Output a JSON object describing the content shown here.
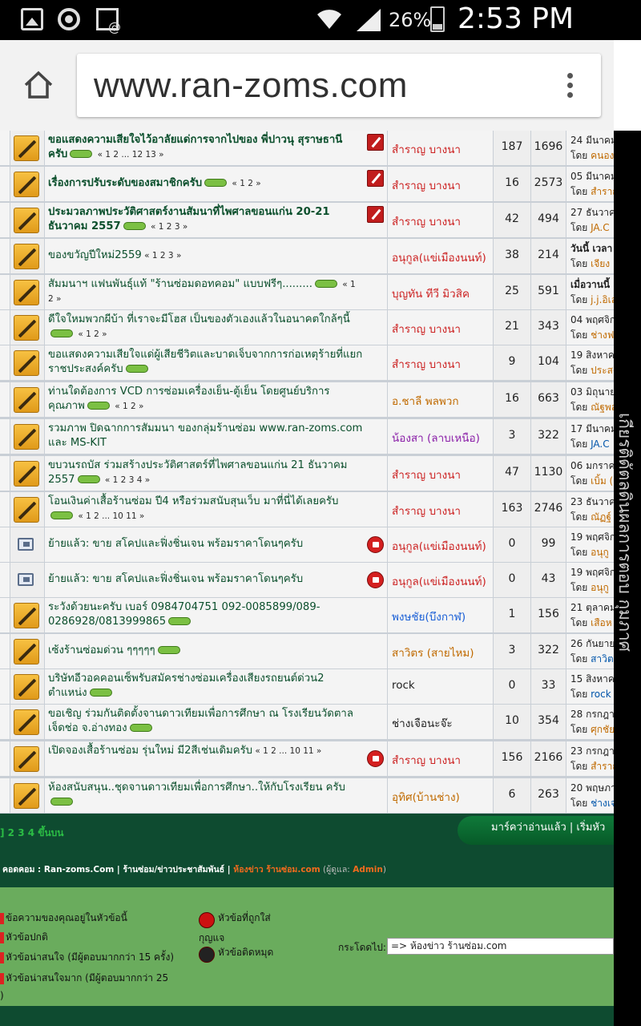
{
  "status": {
    "battery": "26%",
    "time": "2:53 PM"
  },
  "browser": {
    "url": "www.ran-zoms.com"
  },
  "rows": [
    {
      "icon": "topic",
      "title": "ขอแสดงความเสียใจไว้อาลัยแด่การจากไปของ พี่ปาวนุ สุราษธานี ครับ",
      "pages": "« 1 2 ... 12 13 »",
      "bold": true,
      "new": true,
      "badge": "sticky",
      "author": "สำราญ บางนา",
      "author_color": "#cc2222",
      "replies": "187",
      "views": "1696",
      "last1": "24 มีนาคม",
      "last2a": "โดย ",
      "last2b": "คนอง"
    },
    {
      "icon": "topic",
      "title": "เรื่องการปรับระดับของสมาชิกครับ",
      "pages": "« 1 2 »",
      "bold": true,
      "new": true,
      "badge": "sticky",
      "author": "สำราญ บางนา",
      "author_color": "#cc2222",
      "replies": "16",
      "views": "2573",
      "last1": "05 มีนาคม",
      "last2a": "โดย ",
      "last2b": "สำราญ"
    },
    {
      "icon": "topic",
      "title": "ประมวลภาพประวัติศาสตร์งานสัมนาที่ไพศาลขอนแก่น 20-21 ธันวาคม 2557",
      "pages": "« 1 2 3 »",
      "bold": true,
      "new": true,
      "badge": "sticky",
      "author": "สำราญ บางนา",
      "author_color": "#cc2222",
      "replies": "42",
      "views": "494",
      "last1": "27 ธันวาคม",
      "last2a": "โดย ",
      "last2b": "JA.C"
    },
    {
      "icon": "topic",
      "title": "ของขวัญปีใหม่2559",
      "pages": "« 1 2 3 »",
      "bold": false,
      "new": false,
      "badge": "",
      "author": "อนุกูล(แข่เมืองนนท์)",
      "author_color": "#cc2222",
      "replies": "38",
      "views": "214",
      "last1": "วันนี้ เวลา",
      "last2a": "โดย ",
      "last2b": "เจียง"
    },
    {
      "icon": "topic",
      "title": "สัมมนาฯ แฟนพันธุ์แท้ \"ร้านซ่อมดอทคอม\" แบบฟรีๆ.........",
      "pages": "« 1 2 »",
      "bold": false,
      "new": true,
      "badge": "",
      "author": "บุญทัน ทีวี มิวสิค",
      "author_color": "#cc2222",
      "replies": "25",
      "views": "591",
      "last1": "เมื่อวานนี้ เ",
      "last2a": "โดย ",
      "last2b": "j.j.อิเล"
    },
    {
      "icon": "topic",
      "title": "ดีใจใหมพวกผีบ้า ที่เราจะมีโฮส เป็นของตัวเองแล้วในอนาคตใกล้ๆนี้",
      "pages": "« 1 2 »",
      "bold": false,
      "new": true,
      "badge": "",
      "author": "สำราญ บางนา",
      "author_color": "#cc2222",
      "replies": "21",
      "views": "343",
      "last1": "04 พฤศจิก",
      "last2a": "โดย ",
      "last2b": "ช่างฟ"
    },
    {
      "icon": "topic",
      "title": "ขอแสดงความเสียใจแด่ผู้เสียชีวิตและบาดเจ็บจากการก่อเหตุร้ายที่แยกราชประสงค์ครับ",
      "pages": "",
      "bold": false,
      "new": true,
      "badge": "",
      "author": "สำราญ บางนา",
      "author_color": "#cc2222",
      "replies": "9",
      "views": "104",
      "last1": "19 สิงหาค",
      "last2a": "โดย ",
      "last2b": "ประสง"
    },
    {
      "icon": "topic",
      "title": "ท่านใดต้องการ VCD การซ่อมเครื่องเย็น-ตู้เย็น โดยศูนย์บริการคุณภาพ",
      "pages": "« 1 2 »",
      "bold": false,
      "new": true,
      "badge": "",
      "author": "อ.ชาลี พลพวก",
      "author_color": "#c06a00",
      "replies": "16",
      "views": "663",
      "last1": "03 มิถุนาย",
      "last2a": "โดย ",
      "last2b": "ณัฐพล"
    },
    {
      "icon": "topic",
      "title": "รวมภาพ ปิดฉากการสัมมนา ของกลุ่มร้านซ่อม www.ran-zoms.com และ MS-KIT",
      "pages": "",
      "bold": false,
      "new": false,
      "badge": "",
      "author": "น้องสา (ลาบเหนือ)",
      "author_color": "#8a1fa8",
      "replies": "3",
      "views": "322",
      "last1": "17 มีนาคม",
      "last2a": "โดย ",
      "last2b": "JA.C"
    },
    {
      "icon": "topic",
      "title": "ขบวนรถบัส ร่วมสร้างประวัติศาสตร์ที่ไพศาลขอนแก่น 21 ธันวาคม 2557",
      "pages": "« 1 2 3 4 »",
      "bold": false,
      "new": true,
      "badge": "",
      "author": "สำราญ บางนา",
      "author_color": "#cc2222",
      "replies": "47",
      "views": "1130",
      "last1": "06 มกราค",
      "last2a": "โดย ",
      "last2b": "เบิ้ม ("
    },
    {
      "icon": "topic",
      "title": "โอนเงินค่าเสื้อร้านซ่อม ปี4 หรือร่วมสนับสุนเว็บ มาที่นี่ได้เลยครับ",
      "pages": "« 1 2 ... 10 11 »",
      "bold": false,
      "new": true,
      "badge": "",
      "author": "สำราญ บางนา",
      "author_color": "#cc2222",
      "replies": "163",
      "views": "2746",
      "last1": "23 ธันวาค",
      "last2a": "โดย ",
      "last2b": "ณัฏฐ์"
    },
    {
      "icon": "moved",
      "title": "ย้ายแล้ว: ขาย สโคปและฟิ่งชิ่นเจน พร้อมราคาโดนๆครับ",
      "pages": "",
      "bold": false,
      "new": false,
      "badge": "lock",
      "author": "อนุกูล(แข่เมืองนนท์)",
      "author_color": "#cc2222",
      "replies": "0",
      "views": "99",
      "last1": "19 พฤศจิก",
      "last2a": "โดย ",
      "last2b": "อนุกู"
    },
    {
      "icon": "moved",
      "title": "ย้ายแล้ว: ขาย สโคปและฟิ่งชิ่นเจน พร้อมราคาโดนๆครับ",
      "pages": "",
      "bold": false,
      "new": false,
      "badge": "lock",
      "author": "อนุกูล(แข่เมืองนนท์)",
      "author_color": "#cc2222",
      "replies": "0",
      "views": "43",
      "last1": "19 พฤศจิก",
      "last2a": "โดย ",
      "last2b": "อนุกู"
    },
    {
      "icon": "topic",
      "title": "ระวังด้วยนะครับ เบอร์ 0984704751 092-0085899/089-0286928/0813999865",
      "pages": "",
      "bold": false,
      "new": true,
      "badge": "",
      "author": "พงษชัย(บึงกาฬ)",
      "author_color": "#1a5fd6",
      "replies": "1",
      "views": "156",
      "last1": "21 ตุลาคม",
      "last2a": "โดย ",
      "last2b": "เสือห"
    },
    {
      "icon": "topic",
      "title": "เซ้งร้านซ่อมด่วน ๆๆๆๆๆ",
      "pages": "",
      "bold": false,
      "new": true,
      "badge": "",
      "author": "สาวิตร (สายไหม)",
      "author_color": "#c06a00",
      "replies": "3",
      "views": "322",
      "last1": "26 กันยาย",
      "last2a": "โดย ",
      "last2b": "สาวิต"
    },
    {
      "icon": "topic",
      "title": "บริษัทอีวอคคอนเซ็พรับสมัครช่างซ่อมเครื่องเสียงรถยนต์ด่วน2 ตำแหน่ง",
      "pages": "",
      "bold": false,
      "new": true,
      "badge": "",
      "author": "rock",
      "author_color": "#222222",
      "replies": "0",
      "views": "33",
      "last1": "15 สิงหาค",
      "last2a": "โดย ",
      "last2b": "rock"
    },
    {
      "icon": "topic",
      "title": "ขอเชิญ ร่วมกันติดตั้งจานดาวเทียมเพื่อการศึกษา ณ โรงเรียนวัดตาลเจ็ดช่อ จ.อ่างทอง",
      "pages": "",
      "bold": false,
      "new": true,
      "badge": "",
      "author": "ช่างเจือนะจ๊ะ",
      "author_color": "#222222",
      "replies": "10",
      "views": "354",
      "last1": "28 กรกฎา",
      "last2a": "โดย ",
      "last2b": "ศุกชัย"
    },
    {
      "icon": "topic",
      "title": "เปิดจองเสื้อร้านซ่อม รุ่นใหม่ มี2สีเช่นเดิมครับ",
      "pages": "« 1 2 ... 10 11 »",
      "bold": false,
      "new": false,
      "badge": "lock",
      "author": "สำราญ บางนา",
      "author_color": "#cc2222",
      "replies": "156",
      "views": "2166",
      "last1": "23 กรกฎา",
      "last2a": "โดย ",
      "last2b": "สำราญ"
    },
    {
      "icon": "topic",
      "title": "ห้องสนับสนุน..ชุดจานดาวเทียมเพื่อการศึกษา..ให้กับโรงเรียน ครับ",
      "pages": "",
      "bold": false,
      "new": true,
      "badge": "",
      "author": "อุทิศ(บ้านช่าง)",
      "author_color": "#c06a00",
      "replies": "6",
      "views": "263",
      "last1": "20 พฤษภา",
      "last2a": "โดย ",
      "last2b": "ช่างเจ"
    }
  ],
  "footer": {
    "pages": "] 2 3 4   ขึ้นบน",
    "mark_read": "มาร์คว่าอ่านแล้ว  |  เริ่มหัว",
    "crumb_a": "คอดคอม : Ran-zoms.Com",
    "crumb_sep": " | ",
    "crumb_b": "ร้านซ่อม/ข่าวประชาสัมพันธ์",
    "crumb_c": "ห้องข่าว ร้านซ่อม.com",
    "crumb_mod": " (ผู้ดูแล: ",
    "crumb_admin": "Admin",
    "crumb_end": ")"
  },
  "legend": {
    "l1": "ข้อความของคุณอยู่ในหัวข้อนี้",
    "l2": "หัวข้อปกติ",
    "l3": "หัวข้อน่าสนใจ (มีผู้ตอบมากกว่า 15 ครั้ง)",
    "l4": "หัวข้อน่าสนใจมาก (มีผู้ตอบมากกว่า 25",
    "l5": ")",
    "r1": "หัวข้อที่ถูกใส่",
    "r1b": "กุญแจ",
    "r2": "หัวข้อติดหมุด",
    "jump_label": "กระโดดไป:",
    "jump_value": "=> ห้องข่าว ร้านซ่อม.com"
  },
  "side_text": "เกียรติดัตลดินผลการตอบ กุมภาศ"
}
